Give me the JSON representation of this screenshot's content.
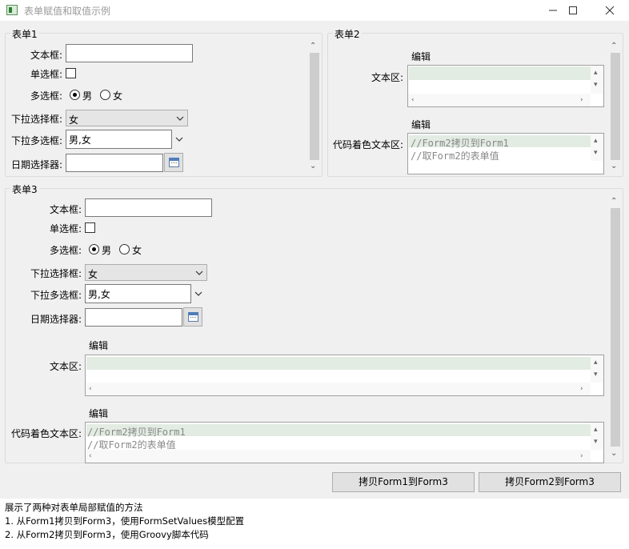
{
  "window": {
    "title": "表单赋值和取值示例",
    "controls": [
      "minimize-icon",
      "maximize-icon",
      "close-icon"
    ]
  },
  "form1": {
    "title": "表单1",
    "text_label": "文本框:",
    "text_value": "",
    "checkbox_label": "单选框:",
    "radio_label": "多选框:",
    "radio_options": [
      "男",
      "女"
    ],
    "radio_selected": "男",
    "select_label": "下拉选择框:",
    "select_value": "女",
    "multiselect_label": "下拉多选框:",
    "multiselect_value": "男,女",
    "date_label": "日期选择器:",
    "date_value": ""
  },
  "form2": {
    "title": "表单2",
    "edit_label_1": "编辑",
    "textarea_label": "文本区:",
    "edit_label_2": "编辑",
    "code_label": "代码着色文本区:",
    "code_lines": [
      "//Form2拷贝到Form1",
      "//取Form2的表单值"
    ]
  },
  "form3": {
    "title": "表单3",
    "text_label": "文本框:",
    "text_value": "",
    "checkbox_label": "单选框:",
    "radio_label": "多选框:",
    "radio_options": [
      "男",
      "女"
    ],
    "radio_selected": "男",
    "select_label": "下拉选择框:",
    "select_value": "女",
    "multiselect_label": "下拉多选框:",
    "multiselect_value": "男,女",
    "date_label": "日期选择器:",
    "date_value": "",
    "edit_label_1": "编辑",
    "textarea_label": "文本区:",
    "edit_label_2": "编辑",
    "code_label": "代码着色文本区:",
    "code_lines": [
      "//Form2拷贝到Form1",
      "//取Form2的表单值"
    ]
  },
  "buttons": {
    "copy_1_to_3": "拷贝Form1到Form3",
    "copy_2_to_3": "拷贝Form2到Form3"
  },
  "description": {
    "lines": [
      "展示了两种对表单局部赋值的方法",
      "1. 从Form1拷贝到Form3，使用FormSetValues模型配置",
      "2. 从Form2拷贝到Form3，使用Groovy脚本代码"
    ]
  },
  "colors": {
    "window_bg": "#f0f0f0",
    "highlight_line": "#e3ece3",
    "code_text": "#888888"
  }
}
